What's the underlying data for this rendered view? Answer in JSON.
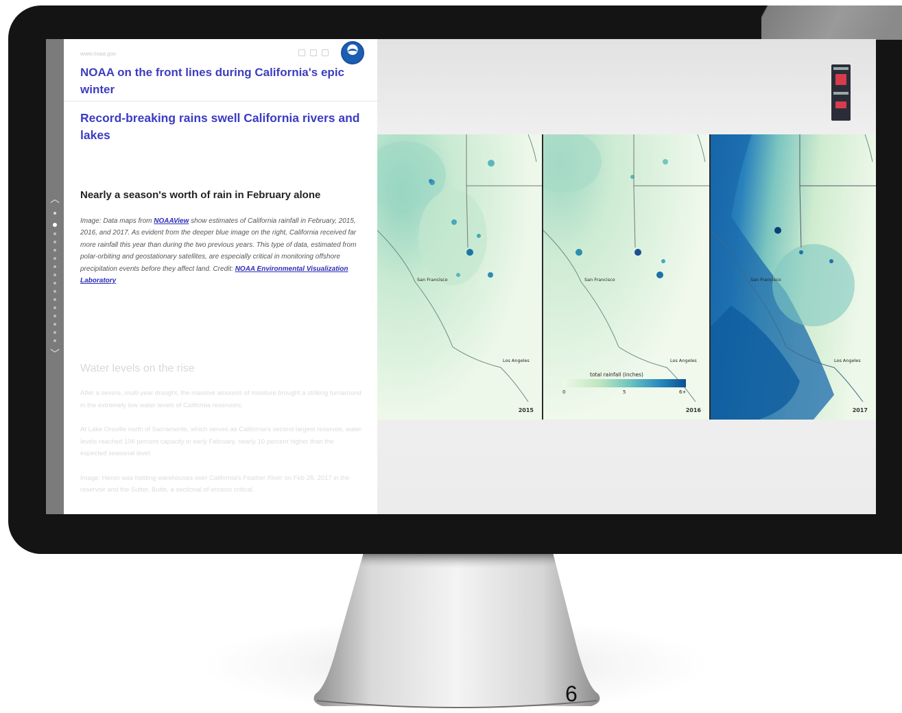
{
  "article": {
    "site_url": "www.noaa.gov",
    "header_title": "NOAA on the front lines during California's epic winter",
    "story_title": "Record-breaking rains swell California rivers and lakes",
    "section_heading": "Nearly a season's worth of rain in February alone",
    "caption": {
      "prefix": "Image: Data maps from ",
      "link1": "NOAAView",
      "middle": " show estimates of California rainfall in February, 2015, 2016, and 2017. As evident from the deeper blue image on the right, California received far more rainfall this year than during the two previous years. This type of data, estimated from polar-orbiting and geostationary satellites, are especially critical in monitoring offshore precipitation events before they affect land. Credit: ",
      "link2": "NOAA Environmental Visualization Laboratory"
    },
    "faded_heading": "Water levels on the rise",
    "faded_paragraphs": [
      "After a severe, multi-year drought, the massive amounts of moisture brought a striking turnaround in the extremely low water levels of California reservoirs.",
      "At Lake Oroville north of Sacramento, which serves as California's second largest reservoir, water levels reached 106 percent capacity in early February, nearly 10 percent higher than the expected seasonal level.",
      "Image: Heron was holding warehouses over California's Feather River on Feb 28, 2017 in the reservoir and the Sutter, Butte, a sectional of erosion critical."
    ]
  },
  "maps": {
    "panels": [
      {
        "year": "2015",
        "city_sf": "San Francisco",
        "city_la": "Los Angeles"
      },
      {
        "year": "2016",
        "city_sf": "San Francisco",
        "city_la": "Los Angeles"
      },
      {
        "year": "2017",
        "city_sf": "San Francisco",
        "city_la": "Los Angeles"
      }
    ],
    "legend": {
      "title": "total rainfall (inches)",
      "min": "0",
      "mid": "5",
      "max": "6+"
    }
  },
  "icons": {
    "logo": "noaa-logo-icon",
    "nav_up": "chevron-up-icon",
    "nav_down": "chevron-down-icon"
  },
  "colors": {
    "link_blue": "#3b3bc4",
    "bezel": "#141414",
    "rain_dark": "#0b4f95"
  },
  "slide": {
    "page_number": "6"
  }
}
